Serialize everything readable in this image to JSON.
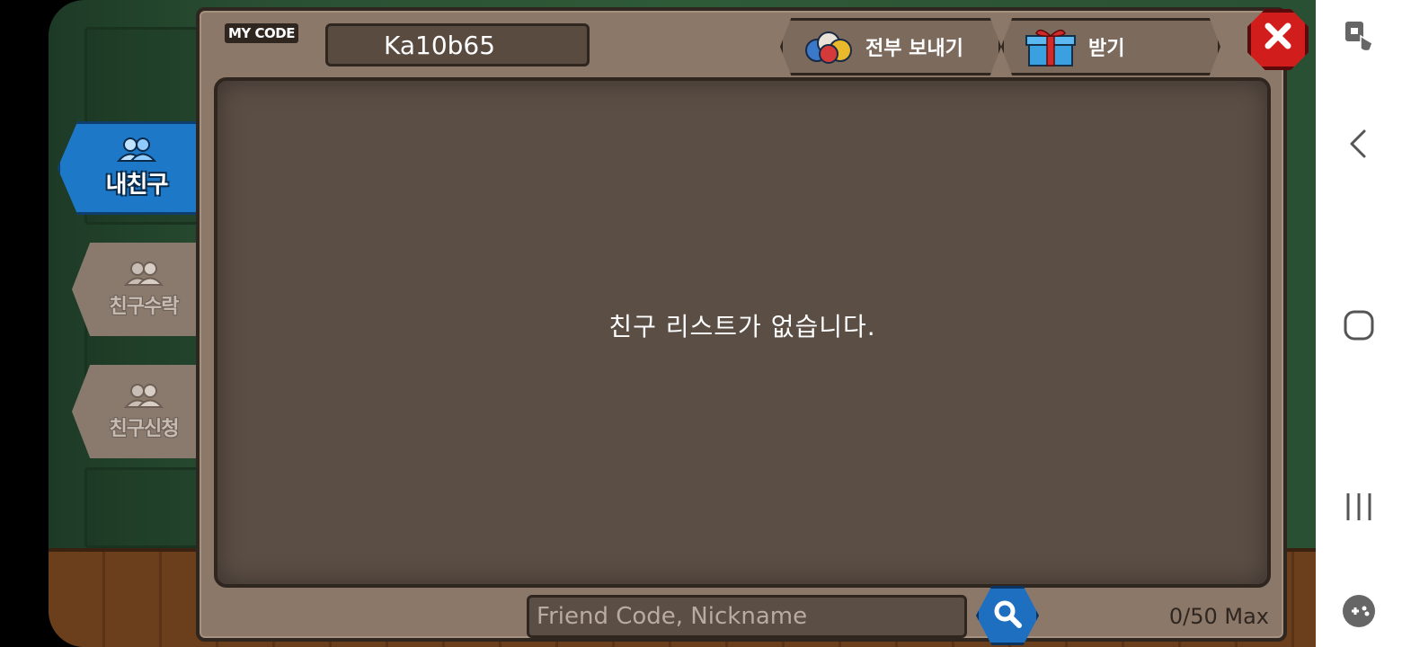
{
  "header": {
    "my_code_label": "MY CODE",
    "my_code_value": "Ka10b65",
    "send_all_label": "전부 보내기",
    "receive_label": "받기"
  },
  "tabs": [
    {
      "label": "내친구",
      "active": true
    },
    {
      "label": "친구수락",
      "active": false
    },
    {
      "label": "친구신청",
      "active": false
    }
  ],
  "main": {
    "empty_message": "친구 리스트가 없습니다."
  },
  "search": {
    "placeholder": "Friend Code, Nickname",
    "count_text": "0/50 Max"
  },
  "icons": {
    "send_all": "coins-icon",
    "receive": "gift-icon",
    "close": "close-icon",
    "search": "search-icon",
    "friends": "friends-icon"
  },
  "colors": {
    "panel": "#8b7869",
    "list_bg": "#5b4e45",
    "active_tab": "#1e78c8",
    "close": "#d21d1d"
  }
}
